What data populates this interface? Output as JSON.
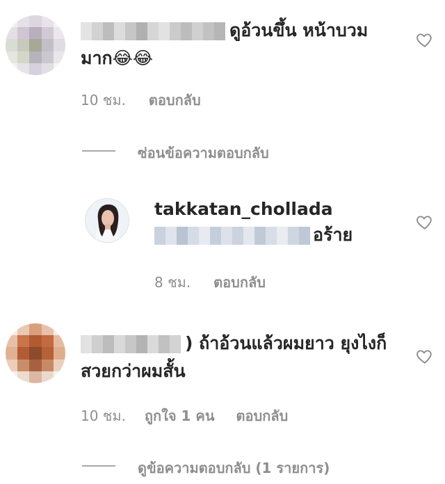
{
  "comments": [
    {
      "text_line1": "ดูอ้วนขึ้น หน้าบวม",
      "text_line2": "มาก😂😂",
      "time": "10 ชม.",
      "reply_label": "ตอบกลับ",
      "hide_replies_label": "ซ่อนข้อความตอบกลับ"
    }
  ],
  "reply": {
    "username": "takkatan_chollada",
    "text_suffix": "อร้าย",
    "time": "8 ชม.",
    "reply_label": "ตอบกลับ"
  },
  "comment2": {
    "text_line1": ") ถ้าอ้วนแล้วผมยาว ยุงไงก็",
    "text_line2": "สวยกว่าผมสั้น",
    "time": "10 ชม.",
    "likes": "ถูกใจ 1 คน",
    "reply_label": "ตอบกลับ",
    "view_replies_label": "ดูข้อความตอบกลับ (1 รายการ)"
  },
  "icons": {
    "like": "heart-outline-icon"
  }
}
